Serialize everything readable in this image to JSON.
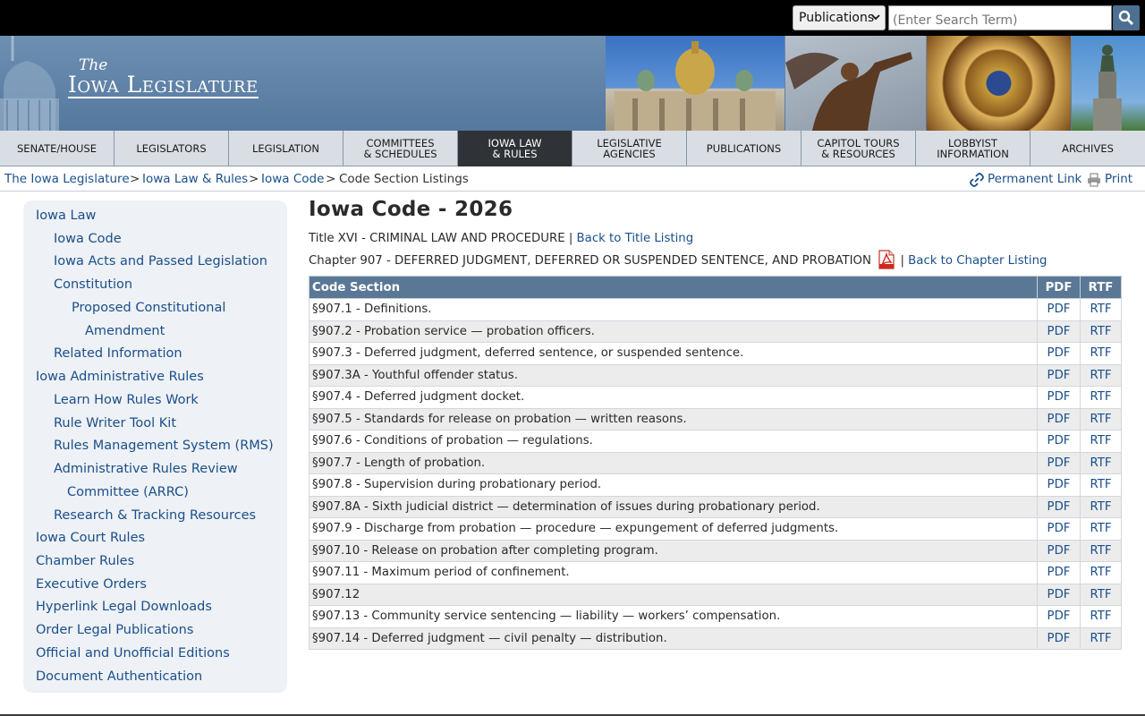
{
  "topbar": {
    "select_value": "Publications",
    "search_placeholder": "(Enter Search Term)"
  },
  "banner": {
    "logo_the": "The",
    "logo_name": "Iowa Legislature"
  },
  "nav": [
    {
      "label_1": "SENATE/HOUSE",
      "label_2": ""
    },
    {
      "label_1": "LEGISLATORS",
      "label_2": ""
    },
    {
      "label_1": "LEGISLATION",
      "label_2": ""
    },
    {
      "label_1": "COMMITTEES",
      "label_2": "& SCHEDULES"
    },
    {
      "label_1": "IOWA LAW",
      "label_2": "& RULES"
    },
    {
      "label_1": "LEGISLATIVE",
      "label_2": "AGENCIES"
    },
    {
      "label_1": "PUBLICATIONS",
      "label_2": ""
    },
    {
      "label_1": "CAPITOL TOURS",
      "label_2": "& RESOURCES"
    },
    {
      "label_1": "LOBBYIST",
      "label_2": "INFORMATION"
    },
    {
      "label_1": "ARCHIVES",
      "label_2": ""
    }
  ],
  "breadcrumb": {
    "items": [
      "The Iowa Legislature",
      "Iowa Law & Rules",
      "Iowa Code"
    ],
    "separator": ">",
    "current": "Code Section Listings",
    "permalink": "Permanent Link",
    "print": "Print"
  },
  "sidebar": {
    "items": [
      "Iowa Law",
      "Iowa Code",
      "Iowa Acts and Passed Legislation",
      "Constitution",
      "Proposed Constitutional",
      "Amendment",
      "Related Information",
      "Iowa Administrative Rules",
      "Learn How Rules Work",
      "Rule Writer Tool Kit",
      "Rules Management System (RMS)",
      "Administrative Rules Review",
      "Committee (ARRC)",
      "Research & Tracking Resources",
      "Iowa Court Rules",
      "Chamber Rules",
      "Executive Orders",
      "Hyperlink Legal Downloads",
      "Order Legal Publications",
      "Official and Unofficial Editions",
      "Document Authentication"
    ]
  },
  "main": {
    "title": "Iowa Code - 2026",
    "title_line": "Title XVI - CRIMINAL LAW AND PROCEDURE |",
    "back_title": "Back to Title Listing",
    "chapter_line": "Chapter 907 - DEFERRED JUDGMENT, DEFERRED OR SUSPENDED SENTENCE, AND PROBATION",
    "chapter_sep": "|",
    "back_chapter": "Back to Chapter Listing",
    "table": {
      "headers": [
        "Code Section",
        "PDF",
        "RTF"
      ],
      "pdf_label": "PDF",
      "rtf_label": "RTF",
      "rows": [
        "§907.1 - Definitions.",
        "§907.2 - Probation service — probation officers.",
        "§907.3 - Deferred judgment, deferred sentence, or suspended sentence.",
        "§907.3A - Youthful offender status.",
        "§907.4 - Deferred judgment docket.",
        "§907.5 - Standards for release on probation — written reasons.",
        "§907.6 - Conditions of probation — regulations.",
        "§907.7 - Length of probation.",
        "§907.8 - Supervision during probationary period.",
        "§907.8A - Sixth judicial district — determination of issues during probationary period.",
        "§907.9 - Discharge from probation — procedure — expungement of deferred judgments.",
        "§907.10 - Release on probation after completing program.",
        "§907.11 - Maximum period of confinement.",
        "§907.12",
        "§907.13 - Community service sentencing — liability — workers’ compensation.",
        "§907.14 - Deferred judgment — civil penalty — distribution."
      ]
    }
  }
}
